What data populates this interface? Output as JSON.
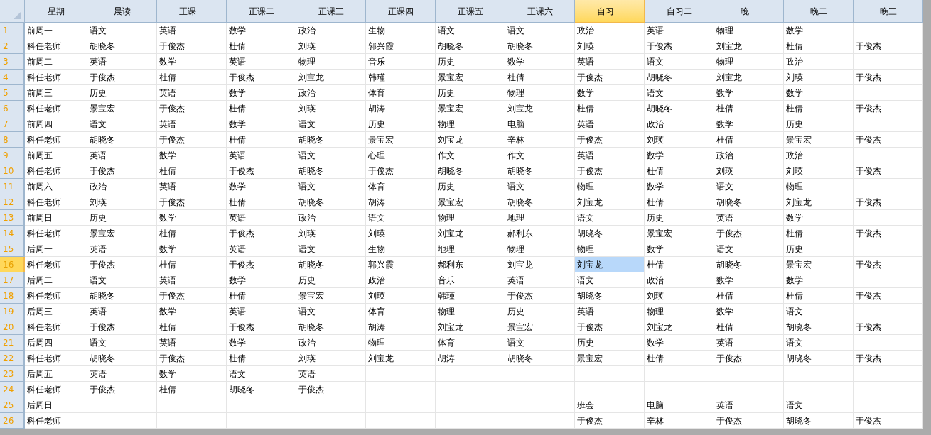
{
  "columns": [
    {
      "label": "星期",
      "selected": false
    },
    {
      "label": "晨读",
      "selected": false
    },
    {
      "label": "正课一",
      "selected": false
    },
    {
      "label": "正课二",
      "selected": false
    },
    {
      "label": "正课三",
      "selected": false
    },
    {
      "label": "正课四",
      "selected": false
    },
    {
      "label": "正课五",
      "selected": false
    },
    {
      "label": "正课六",
      "selected": false
    },
    {
      "label": "自习一",
      "selected": true
    },
    {
      "label": "自习二",
      "selected": false
    },
    {
      "label": "晚一",
      "selected": false
    },
    {
      "label": "晚二",
      "selected": false
    },
    {
      "label": "晚三",
      "selected": false
    }
  ],
  "rows": [
    {
      "number": "1",
      "selected": false,
      "cells": [
        "前周一",
        "语文",
        "英语",
        "数学",
        "政治",
        "生物",
        "语文",
        "语文",
        "政治",
        "英语",
        "物理",
        "数学",
        null
      ]
    },
    {
      "number": "2",
      "selected": false,
      "cells": [
        "科任老师",
        "胡晓冬",
        "于俊杰",
        "杜倩",
        "刘瑛",
        "郭兴霞",
        "胡晓冬",
        "胡晓冬",
        "刘瑛",
        "于俊杰",
        "刘宝龙",
        "杜倩",
        "于俊杰"
      ]
    },
    {
      "number": "3",
      "selected": false,
      "cells": [
        "前周二",
        "英语",
        "数学",
        "英语",
        "物理",
        "音乐",
        "历史",
        "数学",
        "英语",
        "语文",
        "物理",
        "政治",
        null
      ]
    },
    {
      "number": "4",
      "selected": false,
      "cells": [
        "科任老师",
        "于俊杰",
        "杜倩",
        "于俊杰",
        "刘宝龙",
        "韩瑾",
        "景宝宏",
        "杜倩",
        "于俊杰",
        "胡晓冬",
        "刘宝龙",
        "刘瑛",
        "于俊杰"
      ]
    },
    {
      "number": "5",
      "selected": false,
      "cells": [
        "前周三",
        "历史",
        "英语",
        "数学",
        "政治",
        "体育",
        "历史",
        "物理",
        "数学",
        "语文",
        "数学",
        "数学",
        null
      ]
    },
    {
      "number": "6",
      "selected": false,
      "cells": [
        "科任老师",
        "景宝宏",
        "于俊杰",
        "杜倩",
        "刘瑛",
        "胡涛",
        "景宝宏",
        "刘宝龙",
        "杜倩",
        "胡晓冬",
        "杜倩",
        "杜倩",
        "于俊杰"
      ]
    },
    {
      "number": "7",
      "selected": false,
      "cells": [
        "前周四",
        "语文",
        "英语",
        "数学",
        "语文",
        "历史",
        "物理",
        "电脑",
        "英语",
        "政治",
        "数学",
        "历史",
        null
      ]
    },
    {
      "number": "8",
      "selected": false,
      "cells": [
        "科任老师",
        "胡晓冬",
        "于俊杰",
        "杜倩",
        "胡晓冬",
        "景宝宏",
        "刘宝龙",
        "辛林",
        "于俊杰",
        "刘瑛",
        "杜倩",
        "景宝宏",
        "于俊杰"
      ]
    },
    {
      "number": "9",
      "selected": false,
      "cells": [
        "前周五",
        "英语",
        "数学",
        "英语",
        "语文",
        "心理",
        "作文",
        "作文",
        "英语",
        "数学",
        "政治",
        "政治",
        null
      ]
    },
    {
      "number": "10",
      "selected": false,
      "cells": [
        "科任老师",
        "于俊杰",
        "杜倩",
        "于俊杰",
        "胡晓冬",
        "于俊杰",
        "胡晓冬",
        "胡晓冬",
        "于俊杰",
        "杜倩",
        "刘瑛",
        "刘瑛",
        "于俊杰"
      ]
    },
    {
      "number": "11",
      "selected": false,
      "cells": [
        "前周六",
        "政治",
        "英语",
        "数学",
        "语文",
        "体育",
        "历史",
        "语文",
        "物理",
        "数学",
        "语文",
        "物理",
        null
      ]
    },
    {
      "number": "12",
      "selected": false,
      "cells": [
        "科任老师",
        "刘瑛",
        "于俊杰",
        "杜倩",
        "胡晓冬",
        "胡涛",
        "景宝宏",
        "胡晓冬",
        "刘宝龙",
        "杜倩",
        "胡晓冬",
        "刘宝龙",
        "于俊杰"
      ]
    },
    {
      "number": "13",
      "selected": false,
      "cells": [
        "前周日",
        "历史",
        "数学",
        "英语",
        "政治",
        "语文",
        "物理",
        "地理",
        "语文",
        "历史",
        "英语",
        "数学",
        null
      ]
    },
    {
      "number": "14",
      "selected": false,
      "cells": [
        "科任老师",
        "景宝宏",
        "杜倩",
        "于俊杰",
        "刘瑛",
        "刘瑛",
        "刘宝龙",
        "郝利东",
        "胡晓冬",
        "景宝宏",
        "于俊杰",
        "杜倩",
        "于俊杰"
      ]
    },
    {
      "number": "15",
      "selected": false,
      "cells": [
        "后周一",
        "英语",
        "数学",
        "英语",
        "语文",
        "生物",
        "地理",
        "物理",
        "物理",
        "数学",
        "语文",
        "历史",
        null
      ]
    },
    {
      "number": "16",
      "selected": true,
      "cells": [
        "科任老师",
        "于俊杰",
        "杜倩",
        "于俊杰",
        "胡晓冬",
        "郭兴霞",
        "郝利东",
        "刘宝龙",
        "刘宝龙",
        "杜倩",
        "胡晓冬",
        "景宝宏",
        "于俊杰"
      ]
    },
    {
      "number": "17",
      "selected": false,
      "cells": [
        "后周二",
        "语文",
        "英语",
        "数学",
        "历史",
        "政治",
        "音乐",
        "英语",
        "语文",
        "政治",
        "数学",
        "数学",
        null
      ]
    },
    {
      "number": "18",
      "selected": false,
      "cells": [
        "科任老师",
        "胡晓冬",
        "于俊杰",
        "杜倩",
        "景宝宏",
        "刘瑛",
        "韩瑾",
        "于俊杰",
        "胡晓冬",
        "刘瑛",
        "杜倩",
        "杜倩",
        "于俊杰"
      ]
    },
    {
      "number": "19",
      "selected": false,
      "cells": [
        "后周三",
        "英语",
        "数学",
        "英语",
        "语文",
        "体育",
        "物理",
        "历史",
        "英语",
        "物理",
        "数学",
        "语文",
        null
      ]
    },
    {
      "number": "20",
      "selected": false,
      "cells": [
        "科任老师",
        "于俊杰",
        "杜倩",
        "于俊杰",
        "胡晓冬",
        "胡涛",
        "刘宝龙",
        "景宝宏",
        "于俊杰",
        "刘宝龙",
        "杜倩",
        "胡晓冬",
        "于俊杰"
      ]
    },
    {
      "number": "21",
      "selected": false,
      "cells": [
        "后周四",
        "语文",
        "英语",
        "数学",
        "政治",
        "物理",
        "体育",
        "语文",
        "历史",
        "数学",
        "英语",
        "语文",
        null
      ]
    },
    {
      "number": "22",
      "selected": false,
      "cells": [
        "科任老师",
        "胡晓冬",
        "于俊杰",
        "杜倩",
        "刘瑛",
        "刘宝龙",
        "胡涛",
        "胡晓冬",
        "景宝宏",
        "杜倩",
        "于俊杰",
        "胡晓冬",
        "于俊杰"
      ]
    },
    {
      "number": "23",
      "selected": false,
      "cells": [
        "后周五",
        "英语",
        "数学",
        "语文",
        "英语",
        null,
        null,
        null,
        null,
        null,
        null,
        null,
        null
      ]
    },
    {
      "number": "24",
      "selected": false,
      "cells": [
        "科任老师",
        "于俊杰",
        "杜倩",
        "胡晓冬",
        "于俊杰",
        null,
        null,
        null,
        null,
        null,
        null,
        null,
        null
      ]
    },
    {
      "number": "25",
      "selected": false,
      "cells": [
        "后周日",
        null,
        null,
        null,
        null,
        null,
        null,
        null,
        "班会",
        "电脑",
        "英语",
        "语文",
        null
      ]
    },
    {
      "number": "26",
      "selected": false,
      "cells": [
        "科任老师",
        null,
        null,
        null,
        null,
        null,
        null,
        null,
        "于俊杰",
        "辛林",
        "于俊杰",
        "胡晓冬",
        "于俊杰"
      ]
    }
  ]
}
